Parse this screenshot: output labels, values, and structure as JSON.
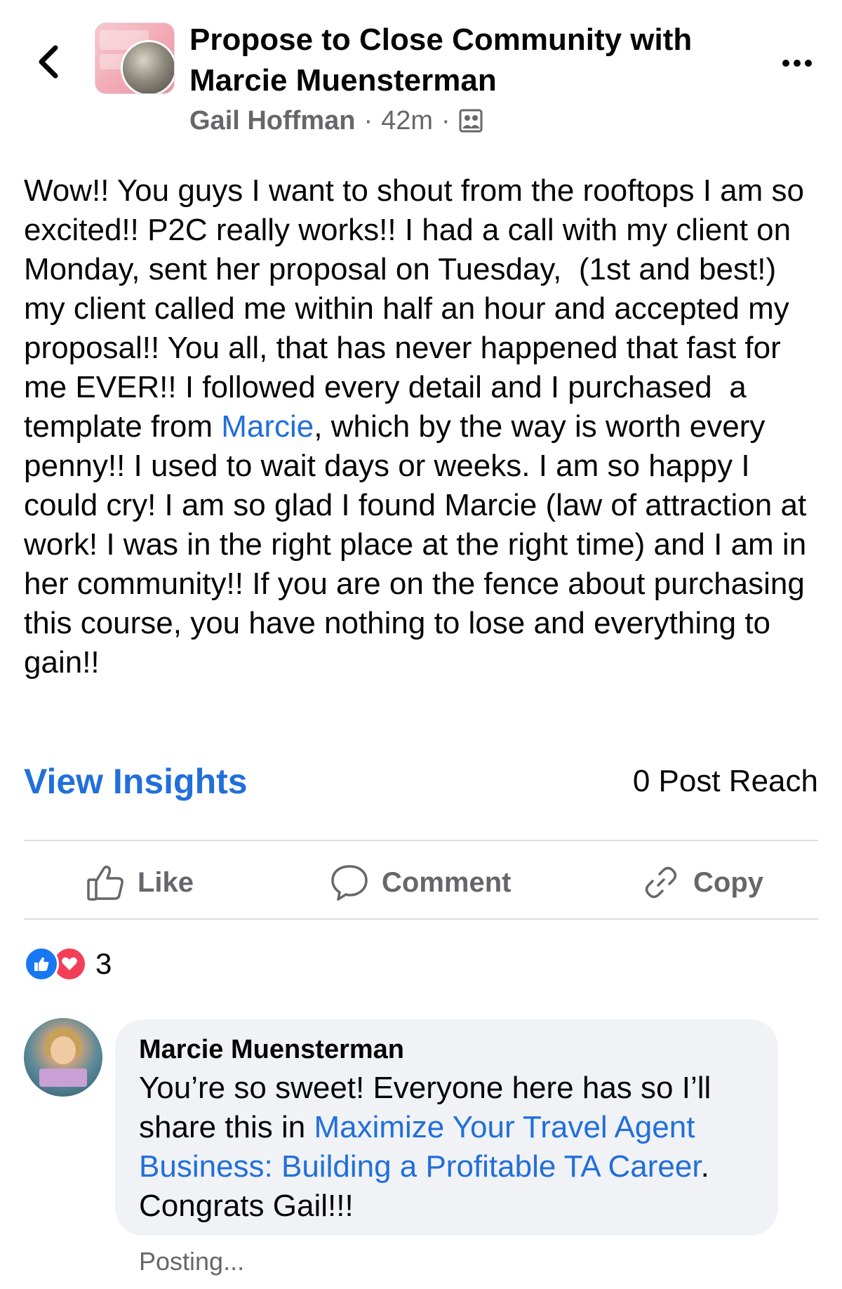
{
  "header": {
    "group_title": "Propose to Close Community with Marcie Muensterman",
    "author": "Gail Hoffman",
    "time": "42m",
    "separator": "·",
    "privacy_icon": "group-members-icon"
  },
  "post": {
    "text_before_mention": "Wow!! You guys I want to shout from the rooftops I am so excited!! P2C really works!! I had a call with my client on Monday, sent her proposal on Tuesday,  (1st and best!) my client called me within half an hour and accepted my proposal!! You all, that has never happened that fast for me EVER!! I followed every detail and I purchased  a template from ",
    "mention": "Marcie",
    "text_after_mention": ", which by the way is worth every penny!! I used to wait days or weeks. I am so happy I could cry! I am so glad I found Marcie (law of attraction at work! I was in the right place at the right time) and I am in her community!! If you are on the fence about purchasing this course, you have nothing to lose and everything to gain!!"
  },
  "insights": {
    "view_label": "View Insights",
    "reach": "0 Post Reach"
  },
  "actions": {
    "like": "Like",
    "comment": "Comment",
    "copy": "Copy"
  },
  "reactions": {
    "count": "3",
    "like_color": "#1877f2",
    "love_color": "#f33e58"
  },
  "comment": {
    "author": "Marcie Muensterman",
    "text_before_link": "You’re so sweet! Everyone here has so I’ll share this in ",
    "link": "Maximize Your Travel Agent Business: Building a Profitable TA Career",
    "text_after_link": ". Congrats Gail!!!",
    "status": "Posting..."
  },
  "colors": {
    "link_blue": "#216fdb",
    "secondary_text": "#65676b",
    "bubble_bg": "#f0f2f5"
  }
}
